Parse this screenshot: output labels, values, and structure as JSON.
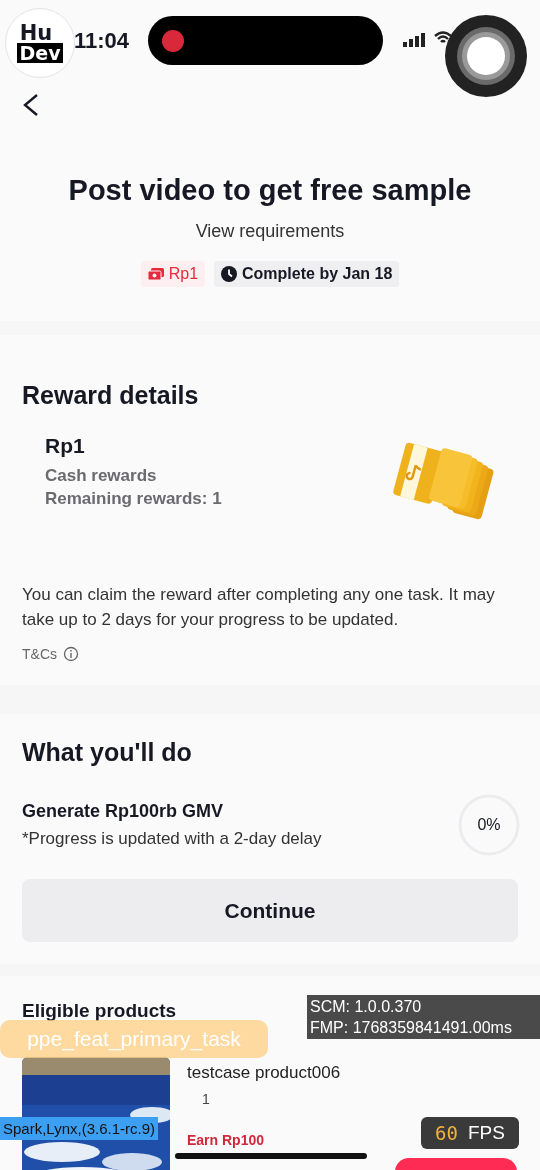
{
  "status_bar": {
    "time": "11:04",
    "recording": true
  },
  "dev_badge": {
    "line_1": "Hu",
    "line_2": "Dev"
  },
  "header": {
    "title": "Post video to get free sample",
    "link": "View requirements",
    "tags": [
      {
        "kind": "reward",
        "text": "Rp1"
      },
      {
        "kind": "deadline",
        "text": "Complete by Jan 18"
      }
    ]
  },
  "reward_details": {
    "heading": "Reward details",
    "amount": "Rp1",
    "type": "Cash rewards",
    "remaining": "Remaining rewards: 1",
    "note": "You can claim the reward after completing any one task. It may take up to 2 days for your progress to be updated.",
    "terms": "T&Cs"
  },
  "tasks": {
    "heading": "What you'll do",
    "items": [
      {
        "title": "Generate Rp100rb GMV",
        "note": "*Progress is updated with a 2-day delay",
        "progress": "0%",
        "level": 0
      }
    ],
    "button": "Continue"
  },
  "products": {
    "heading": "Eligible products",
    "items": [
      {
        "name": "testcase product006",
        "count": "1",
        "earn": "Earn Rp100"
      }
    ]
  },
  "debug": {
    "scm": "SCM: 1.0.0.370",
    "fmp": "FMP: 1768359841491.00ms",
    "feature": "ppe_feat_primary_task",
    "engine": "Spark,Lynx,(3.6.1-rc.9)",
    "fps_value": "60",
    "fps_unit": "FPS"
  }
}
